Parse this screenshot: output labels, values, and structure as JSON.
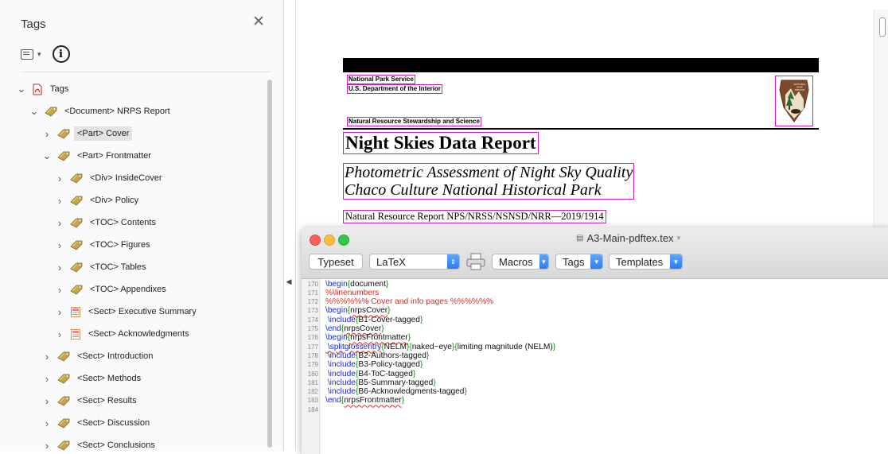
{
  "tags_panel": {
    "title": "Tags",
    "close_glyph": "✕",
    "toolbar": {
      "options_icon": "options-list-icon",
      "info_icon": "info-icon"
    },
    "tree": [
      {
        "label": "Tags",
        "level": 0,
        "expanded": true,
        "icon": "pdf-icon"
      },
      {
        "label": "<Document> NRPS Report",
        "level": 1,
        "expanded": true,
        "icon": "tag-icon"
      },
      {
        "label": "<Part> Cover",
        "level": 2,
        "expanded": false,
        "icon": "tag-icon",
        "selected": true
      },
      {
        "label": "<Part> Frontmatter",
        "level": 2,
        "expanded": true,
        "icon": "tag-icon"
      },
      {
        "label": "<Div> InsideCover",
        "level": 3,
        "expanded": false,
        "icon": "tag-icon"
      },
      {
        "label": "<Div> Policy",
        "level": 3,
        "expanded": false,
        "icon": "tag-icon"
      },
      {
        "label": "<TOC> Contents",
        "level": 3,
        "expanded": false,
        "icon": "tag-icon"
      },
      {
        "label": "<TOC> Figures",
        "level": 3,
        "expanded": false,
        "icon": "tag-icon"
      },
      {
        "label": "<TOC> Tables",
        "level": 3,
        "expanded": false,
        "icon": "tag-icon"
      },
      {
        "label": "<TOC> Appendixes",
        "level": 3,
        "expanded": false,
        "icon": "tag-icon"
      },
      {
        "label": "<Sect> Executive Summary",
        "level": 3,
        "expanded": false,
        "icon": "page-tag-icon"
      },
      {
        "label": "<Sect> Acknowledgments",
        "level": 3,
        "expanded": false,
        "icon": "page-tag-icon"
      },
      {
        "label": "<Sect> Introduction",
        "level": 2,
        "expanded": false,
        "icon": "tag-icon"
      },
      {
        "label": "<Sect> Methods",
        "level": 2,
        "expanded": false,
        "icon": "tag-icon"
      },
      {
        "label": "<Sect> Results",
        "level": 2,
        "expanded": false,
        "icon": "tag-icon"
      },
      {
        "label": "<Sect> Discussion",
        "level": 2,
        "expanded": false,
        "icon": "tag-icon"
      },
      {
        "label": "<Sect> Conclusions",
        "level": 2,
        "expanded": false,
        "icon": "tag-icon"
      }
    ]
  },
  "document": {
    "agency": "National Park Service",
    "department": "U.S. Department of the Interior",
    "directorate": "Natural Resource Stewardship and Science",
    "title": "Night Skies Data Report",
    "subtitle_line1": "Photometric Assessment of Night Sky Quality",
    "subtitle_line2": "Chaco Culture National Historical Park",
    "report_number": "Natural Resource Report NPS/NRSS/NSNSD/NRR—2019/1914",
    "logo": "nps-arrowhead-logo",
    "logo_text": "NATIONAL PARK SERVICE"
  },
  "tex_window": {
    "title": "A3-Main-pdftex.tex",
    "toolbar": {
      "typeset": "Typeset",
      "engine": "LaTeX",
      "macros": "Macros",
      "tags": "Tags",
      "templates": "Templates"
    },
    "code_lines": [
      {
        "n": "170",
        "parts": [
          {
            "t": "\\begin",
            "c": "blue"
          },
          {
            "t": "{",
            "c": "green"
          },
          {
            "t": "document",
            "c": "dark"
          },
          {
            "t": "}",
            "c": "green"
          }
        ]
      },
      {
        "n": "171",
        "parts": [
          {
            "t": "%\\linenumbers",
            "c": "red"
          }
        ]
      },
      {
        "n": "172",
        "parts": [
          {
            "t": "%%%%%% Cover and info pages %%%%%%",
            "c": "red"
          }
        ]
      },
      {
        "n": "173",
        "parts": [
          {
            "t": "\\begin",
            "c": "blue"
          },
          {
            "t": "{",
            "c": "green"
          },
          {
            "t": "nrpsCover",
            "c": "dark",
            "w": true
          },
          {
            "t": "}",
            "c": "green"
          }
        ]
      },
      {
        "n": "174",
        "parts": [
          {
            "t": " \\include",
            "c": "blue"
          },
          {
            "t": "{",
            "c": "green"
          },
          {
            "t": "B1-Cover-tagged",
            "c": "dark"
          },
          {
            "t": "}",
            "c": "green"
          }
        ]
      },
      {
        "n": "175",
        "parts": [
          {
            "t": "\\end",
            "c": "blue"
          },
          {
            "t": "{",
            "c": "green"
          },
          {
            "t": "nrpsCover",
            "c": "dark",
            "w": true
          },
          {
            "t": "}",
            "c": "green"
          }
        ]
      },
      {
        "n": "176",
        "parts": [
          {
            "t": "\\begin",
            "c": "blue"
          },
          {
            "t": "{",
            "c": "green"
          },
          {
            "t": "nrpsFrontmatter",
            "c": "dark",
            "w": true
          },
          {
            "t": "}",
            "c": "green"
          }
        ]
      },
      {
        "n": "177",
        "parts": [
          {
            "t": " \\splitglossentry",
            "c": "blue",
            "w": true
          },
          {
            "t": "{",
            "c": "green"
          },
          {
            "t": "NELM",
            "c": "dark"
          },
          {
            "t": "}{",
            "c": "green"
          },
          {
            "t": "naked~eye",
            "c": "dark"
          },
          {
            "t": "}{",
            "c": "green"
          },
          {
            "t": "limiting magnitude (NELM)",
            "c": "dark"
          },
          {
            "t": "}",
            "c": "green"
          }
        ]
      },
      {
        "n": "178",
        "parts": [
          {
            "t": " \\include",
            "c": "blue"
          },
          {
            "t": "{",
            "c": "green"
          },
          {
            "t": "B2-Authors-tagged",
            "c": "dark"
          },
          {
            "t": "}",
            "c": "green"
          }
        ]
      },
      {
        "n": "179",
        "parts": [
          {
            "t": " \\include",
            "c": "blue"
          },
          {
            "t": "{",
            "c": "green"
          },
          {
            "t": "B3-Policy-tagged",
            "c": "dark"
          },
          {
            "t": "}",
            "c": "green"
          }
        ]
      },
      {
        "n": "180",
        "parts": [
          {
            "t": " \\include",
            "c": "blue"
          },
          {
            "t": "{",
            "c": "green"
          },
          {
            "t": "B4-ToC-tagged",
            "c": "dark"
          },
          {
            "t": "}",
            "c": "green"
          }
        ]
      },
      {
        "n": "181",
        "parts": [
          {
            "t": " \\include",
            "c": "blue"
          },
          {
            "t": "{",
            "c": "green"
          },
          {
            "t": "B5-Summary-tagged",
            "c": "dark"
          },
          {
            "t": "}",
            "c": "green"
          }
        ]
      },
      {
        "n": "182",
        "parts": [
          {
            "t": " \\include",
            "c": "blue"
          },
          {
            "t": "{",
            "c": "green"
          },
          {
            "t": "B6-Acknowledgments-tagged",
            "c": "dark"
          },
          {
            "t": "}",
            "c": "green"
          }
        ]
      },
      {
        "n": "183",
        "parts": [
          {
            "t": "\\end",
            "c": "blue"
          },
          {
            "t": "{",
            "c": "green"
          },
          {
            "t": "nrpsFrontmatter",
            "c": "dark",
            "w": true
          },
          {
            "t": "}",
            "c": "green"
          }
        ]
      },
      {
        "n": "184",
        "parts": []
      }
    ]
  },
  "colors": {
    "tag_highlight": "#d01ad0",
    "code_command": "#1a28d6",
    "code_brace": "#1c8a1c",
    "code_comment": "#e0281f",
    "select_arrow": "#2a7ef3"
  }
}
